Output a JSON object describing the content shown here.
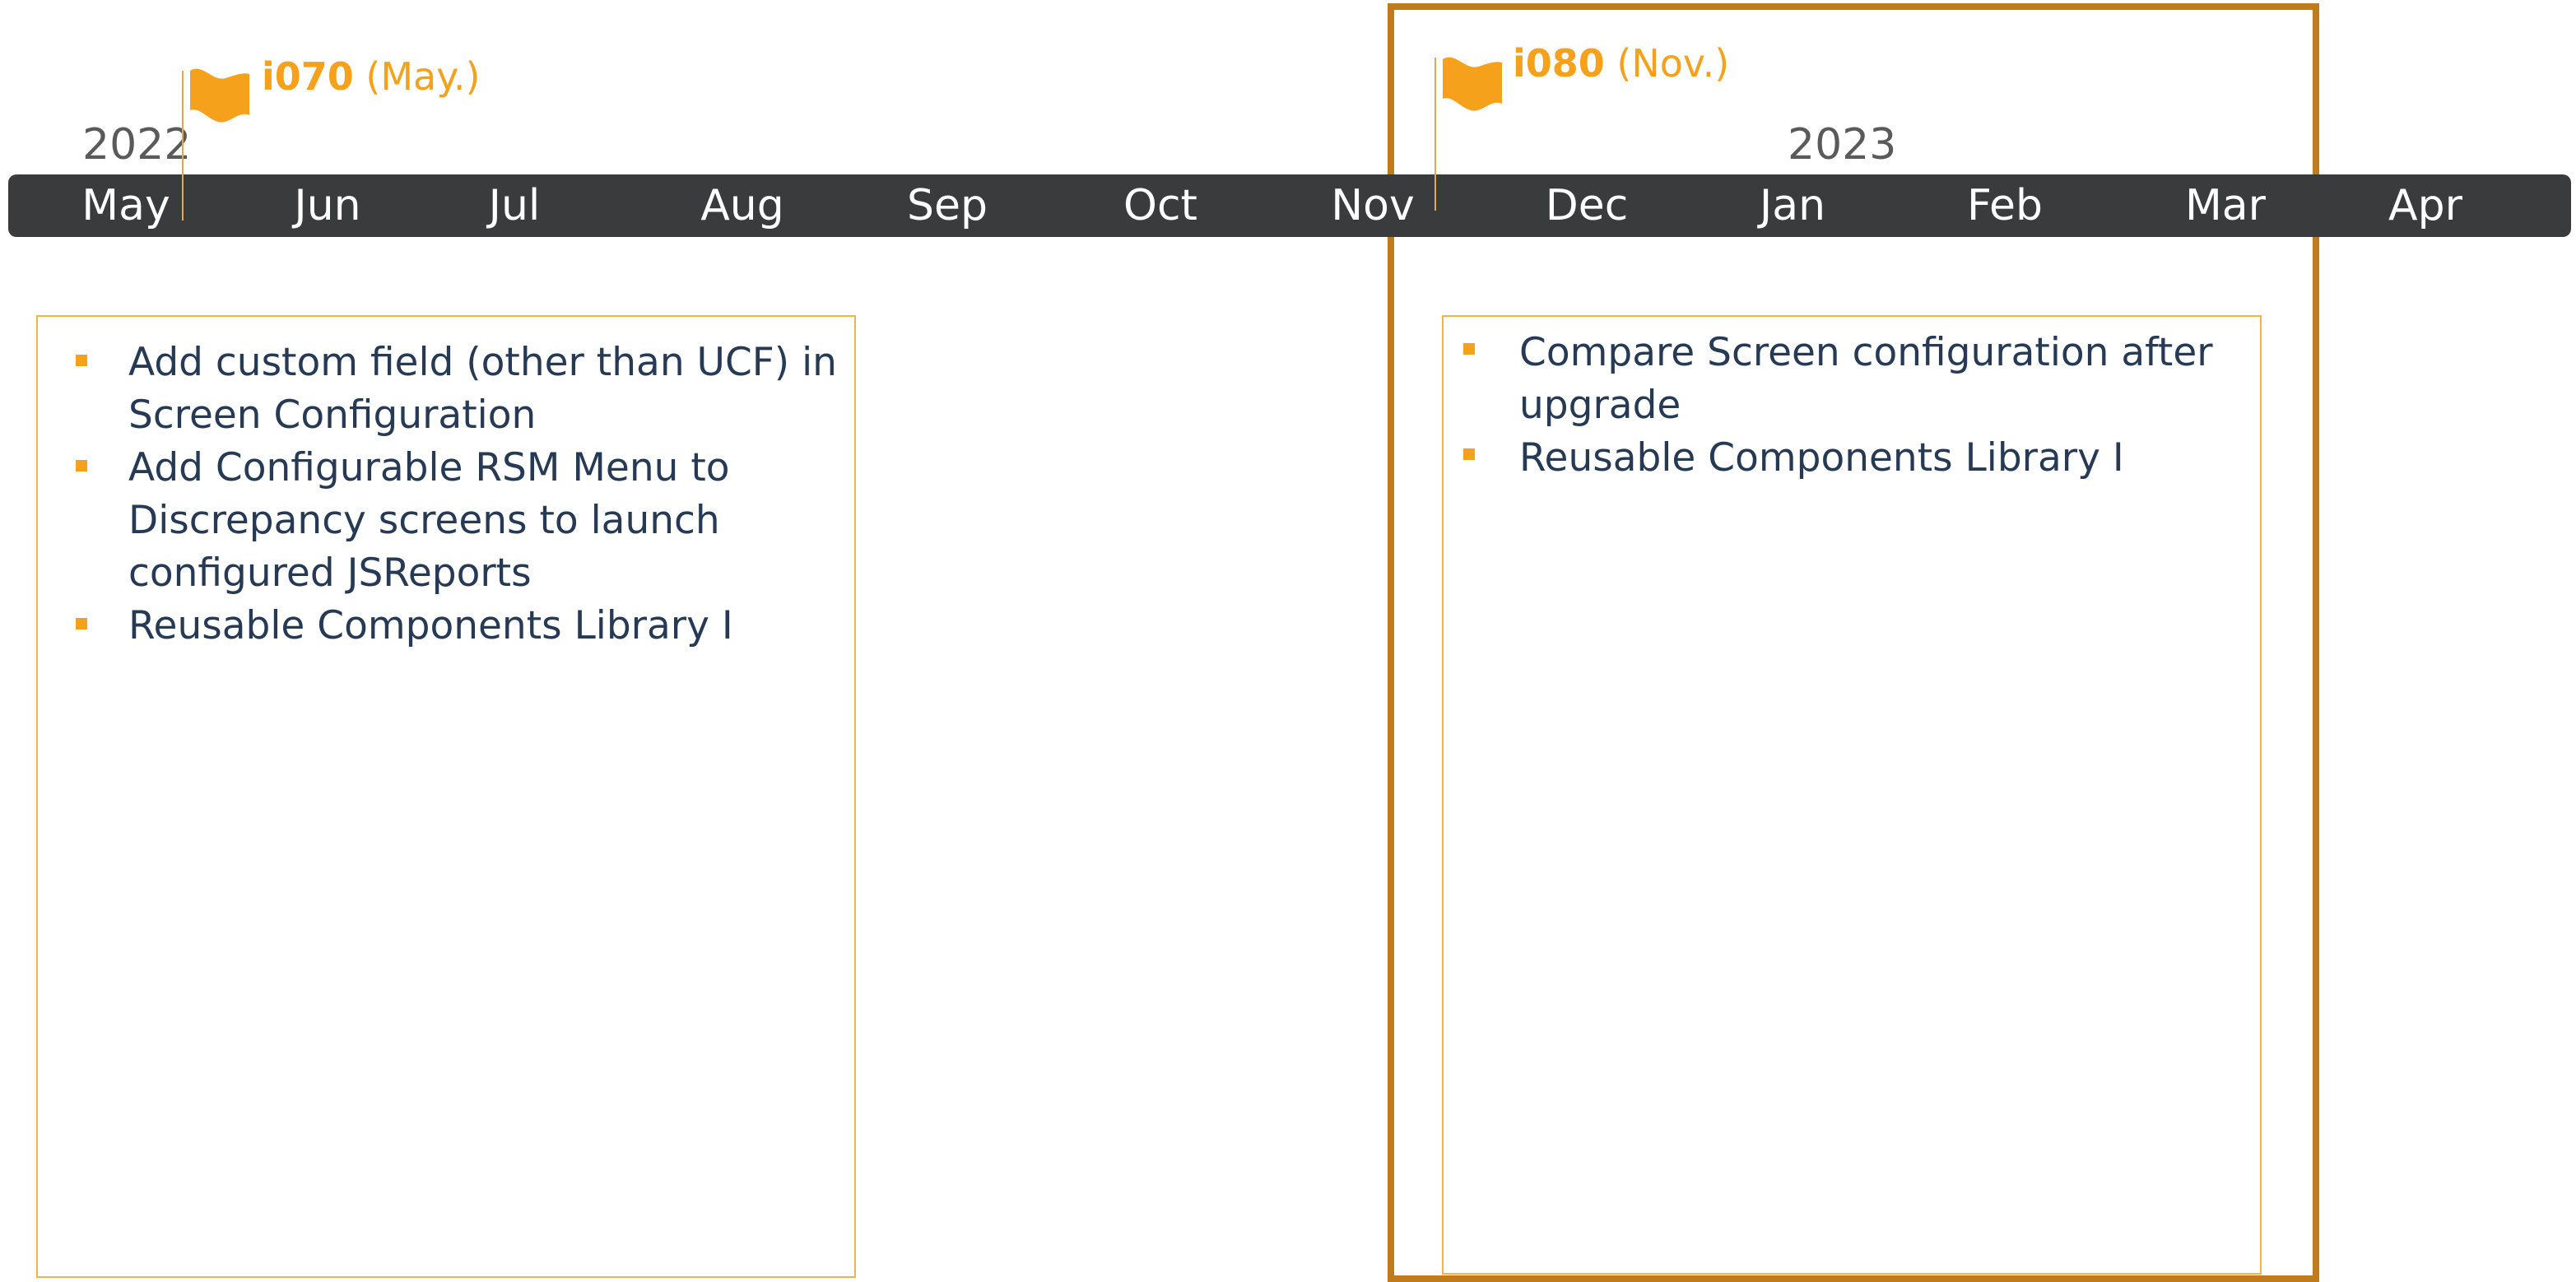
{
  "timeline": {
    "years": [
      {
        "label": "2022"
      },
      {
        "label": "2023"
      }
    ],
    "months": [
      "May",
      "Jun",
      "Jul",
      "Aug",
      "Sep",
      "Oct",
      "Nov",
      "Dec",
      "Jan",
      "Feb",
      "Mar",
      "Apr"
    ]
  },
  "milestones": [
    {
      "code": "i070",
      "period": "(May.)",
      "icon": "flag-icon"
    },
    {
      "code": "i080",
      "period": "(Nov.)",
      "icon": "flag-icon"
    }
  ],
  "releases": [
    {
      "items": [
        "Add custom field (other than UCF) in Screen Configuration",
        "Add Configurable RSM Menu to Discrepancy screens to launch configured JSReports",
        "Reusable Components Library I"
      ]
    },
    {
      "items": [
        "Compare Screen configuration after upgrade",
        "Reusable Components Library I"
      ]
    }
  ],
  "colors": {
    "accent": "#f5a11c",
    "frame": "#bf7b1c",
    "bar": "#3a3b3d",
    "text": "#263a56",
    "box_border": "#f4b24a"
  }
}
